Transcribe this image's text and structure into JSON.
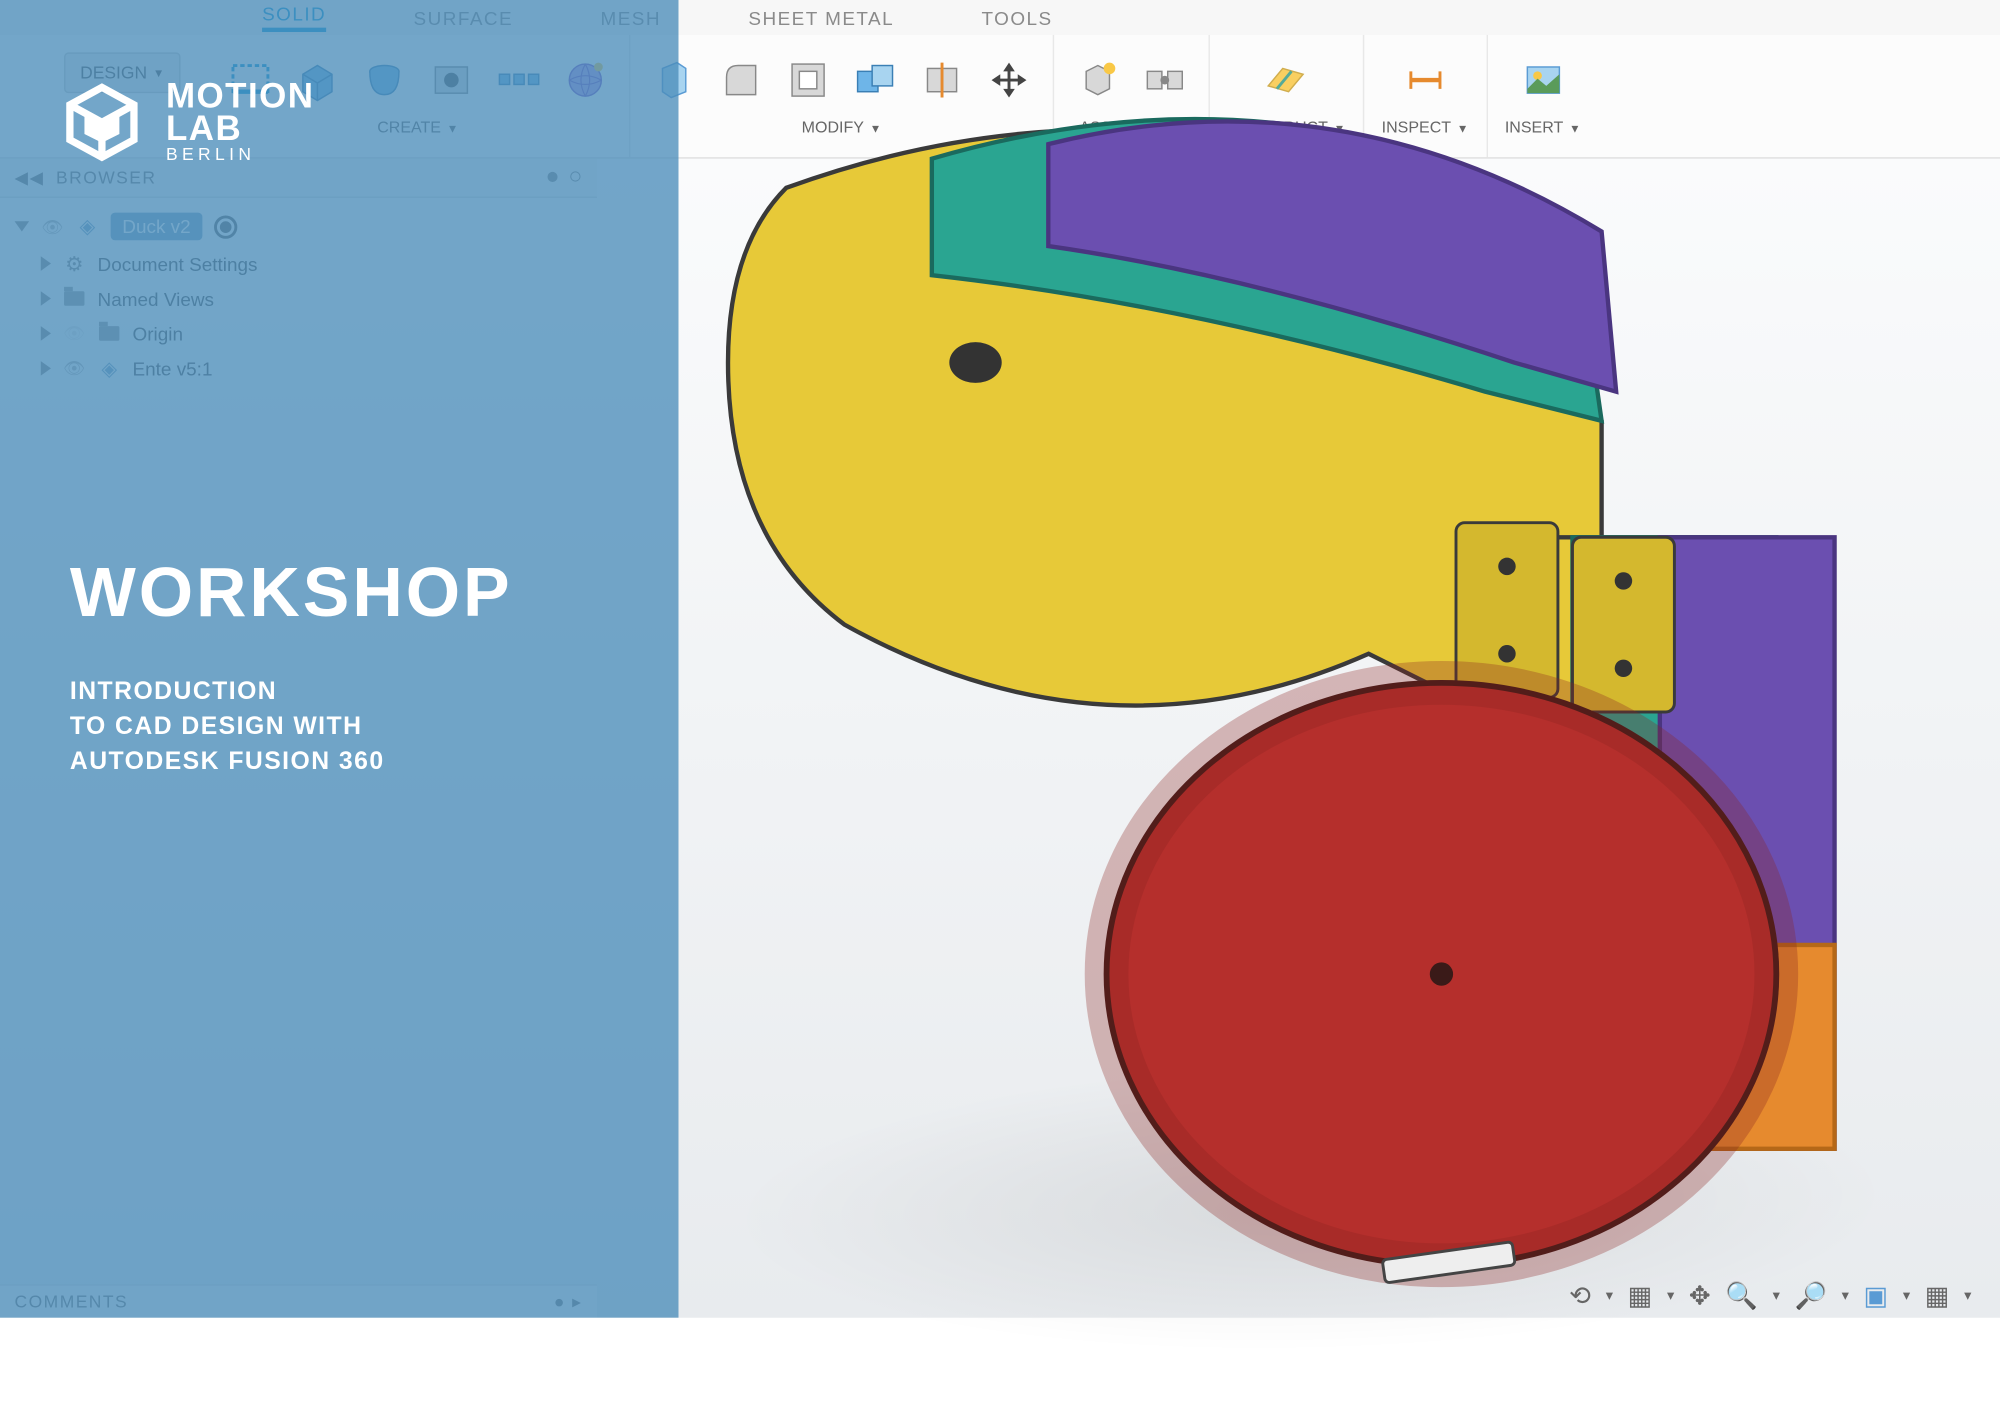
{
  "tabs": {
    "solid": "SOLID",
    "surface": "SURFACE",
    "mesh": "MESH",
    "sheetmetal": "SHEET METAL",
    "tools": "TOOLS"
  },
  "workspace": {
    "design": "DESIGN"
  },
  "ribbon": {
    "create": "CREATE",
    "modify": "MODIFY",
    "assemble": "ASSEMBLE",
    "construct": "CONSTRUCT",
    "inspect": "INSPECT",
    "insert": "INSERT"
  },
  "browser": {
    "title": "BROWSER",
    "root": "Duck v2",
    "items": {
      "docset": "Document Settings",
      "namedviews": "Named Views",
      "origin": "Origin",
      "ente": "Ente v5:1"
    }
  },
  "comments": {
    "title": "COMMENTS"
  },
  "overlay": {
    "brand_top": "MOTION",
    "brand_mid": "LAB",
    "brand_sub": "BERLIN",
    "heading": "WORKSHOP",
    "subtitle": "INTRODUCTION\nTO CAD DESIGN WITH\nAUTODESK FUSION 360"
  },
  "colors": {
    "accent": "#0696d7",
    "overlay": "#4c8dba",
    "yellow": "#e7c938",
    "red": "#b52f2c",
    "teal": "#2aa591",
    "purple": "#6b4fb0",
    "orange": "#e68a2e"
  }
}
